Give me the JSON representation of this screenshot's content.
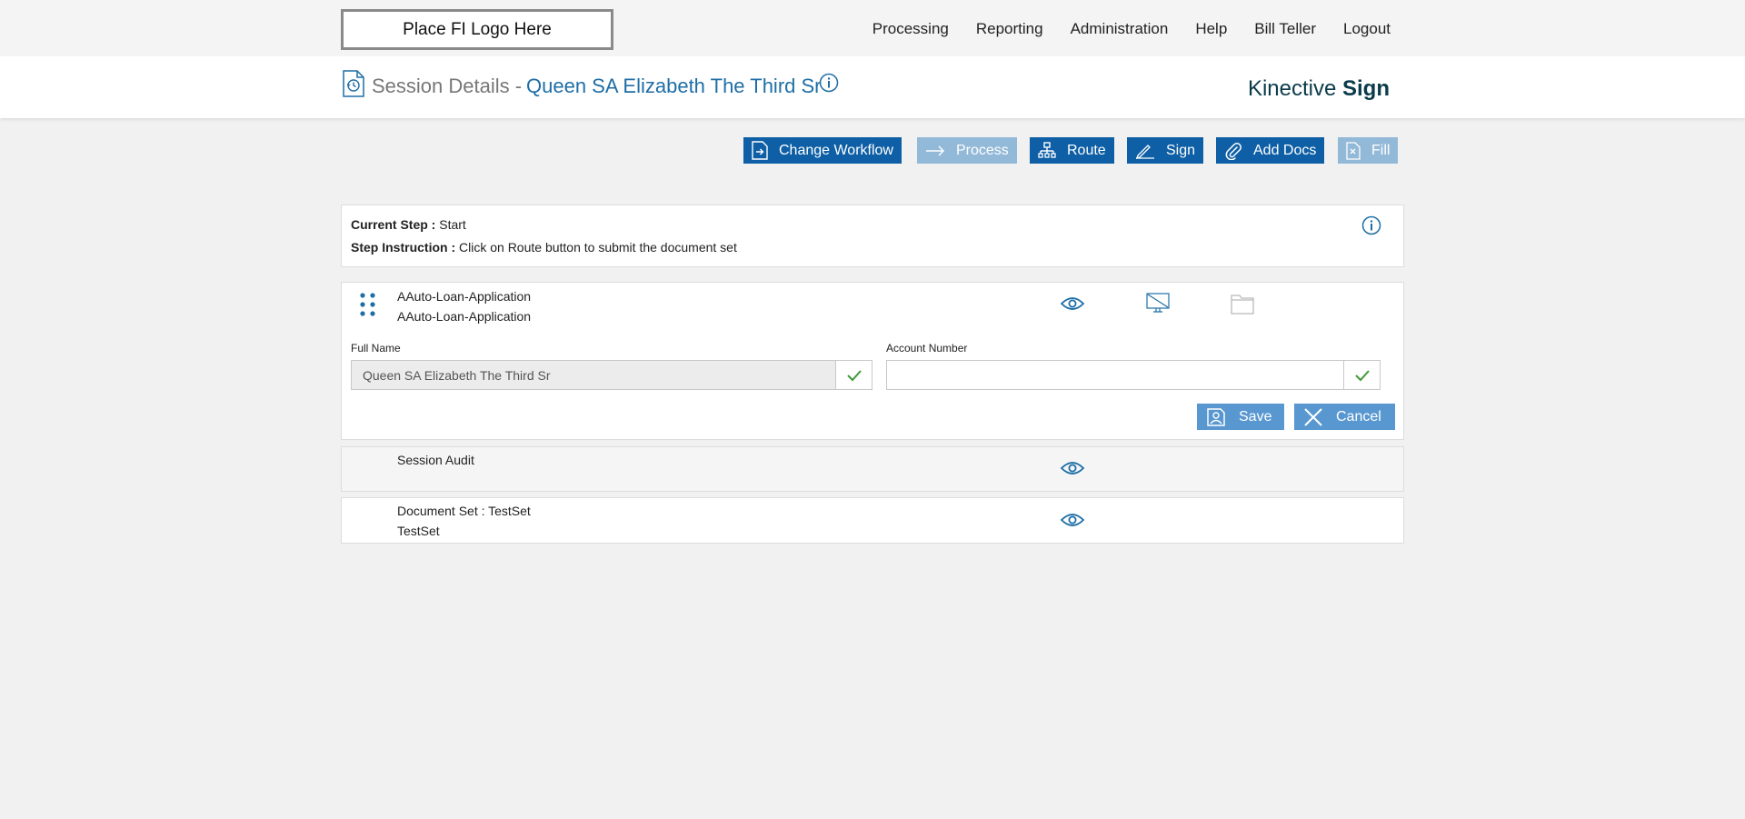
{
  "topbar": {
    "logo_text": "Place FI Logo Here",
    "nav": [
      "Processing",
      "Reporting",
      "Administration",
      "Help",
      "Bill Teller",
      "Logout"
    ]
  },
  "header": {
    "title_prefix": "Session Details -",
    "customer_name": "Queen SA Elizabeth The Third Sr",
    "brand_light": "Kinective",
    "brand_bold": "Sign"
  },
  "toolbar": {
    "change_workflow": "Change Workflow",
    "process": "Process",
    "route": "Route",
    "sign": "Sign",
    "add_docs": "Add Docs",
    "fill": "Fill"
  },
  "step": {
    "current_label": "Current Step :",
    "current_value": "Start",
    "instruction_label": "Step Instruction :",
    "instruction_value": "Click on Route button to submit the document set"
  },
  "document": {
    "name_line1": "AAuto-Loan-Application",
    "name_line2": "AAuto-Loan-Application",
    "fields": [
      {
        "label": "Full Name",
        "value": "Queen SA Elizabeth The Third Sr",
        "placeholder": ""
      },
      {
        "label": "Account Number",
        "value": "",
        "placeholder": ""
      }
    ],
    "save_label": "Save",
    "cancel_label": "Cancel"
  },
  "rows": [
    {
      "line1": "Session Audit"
    },
    {
      "line1": "Document Set : TestSet",
      "line2": "TestSet"
    }
  ],
  "colors": {
    "accent": "#0e5fa5",
    "accent_disabled": "#93b9d8",
    "light_button": "#5897cf",
    "title_blue": "#1e6ea6",
    "check_green": "#3f9a3a"
  }
}
